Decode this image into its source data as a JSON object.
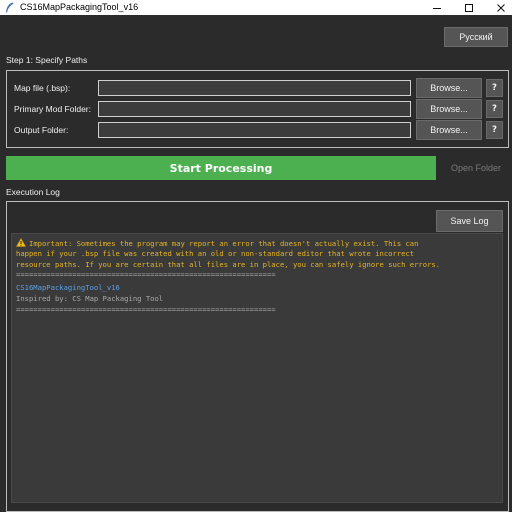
{
  "window": {
    "title": "CS16MapPackagingTool_v16"
  },
  "header": {
    "language_button": "Русский"
  },
  "step1": {
    "title": "Step 1: Specify Paths",
    "rows": [
      {
        "label": "Map file (.bsp):",
        "value": "",
        "browse": "Browse...",
        "help": "?"
      },
      {
        "label": "Primary Mod Folder:",
        "value": "",
        "browse": "Browse...",
        "help": "?"
      },
      {
        "label": "Output Folder:",
        "value": "",
        "browse": "Browse...",
        "help": "?"
      }
    ]
  },
  "actions": {
    "start": "Start Processing",
    "open_folder": "Open Folder"
  },
  "log": {
    "title": "Execution Log",
    "save_button": "Save Log",
    "lines": [
      "Important: Sometimes the program may report an error that doesn't actually exist. This can",
      "happen if your .bsp file was created with an old or non-standard editor that wrote incorrect",
      "resource paths. If you are certain that all files are in place, you can safely ignore such errors.",
      "============================================================",
      "CS16MapPackagingTool_v16",
      "Inspired by: CS Map Packaging Tool",
      "============================================================"
    ]
  },
  "colors": {
    "accent_green": "#4caf50",
    "warning": "#e6b422",
    "info_blue": "#5aa0e6",
    "muted": "#a8a8a8",
    "background": "#2b2b2b"
  },
  "icons": {
    "app": "feather-icon",
    "warning": "warning-triangle-icon"
  }
}
